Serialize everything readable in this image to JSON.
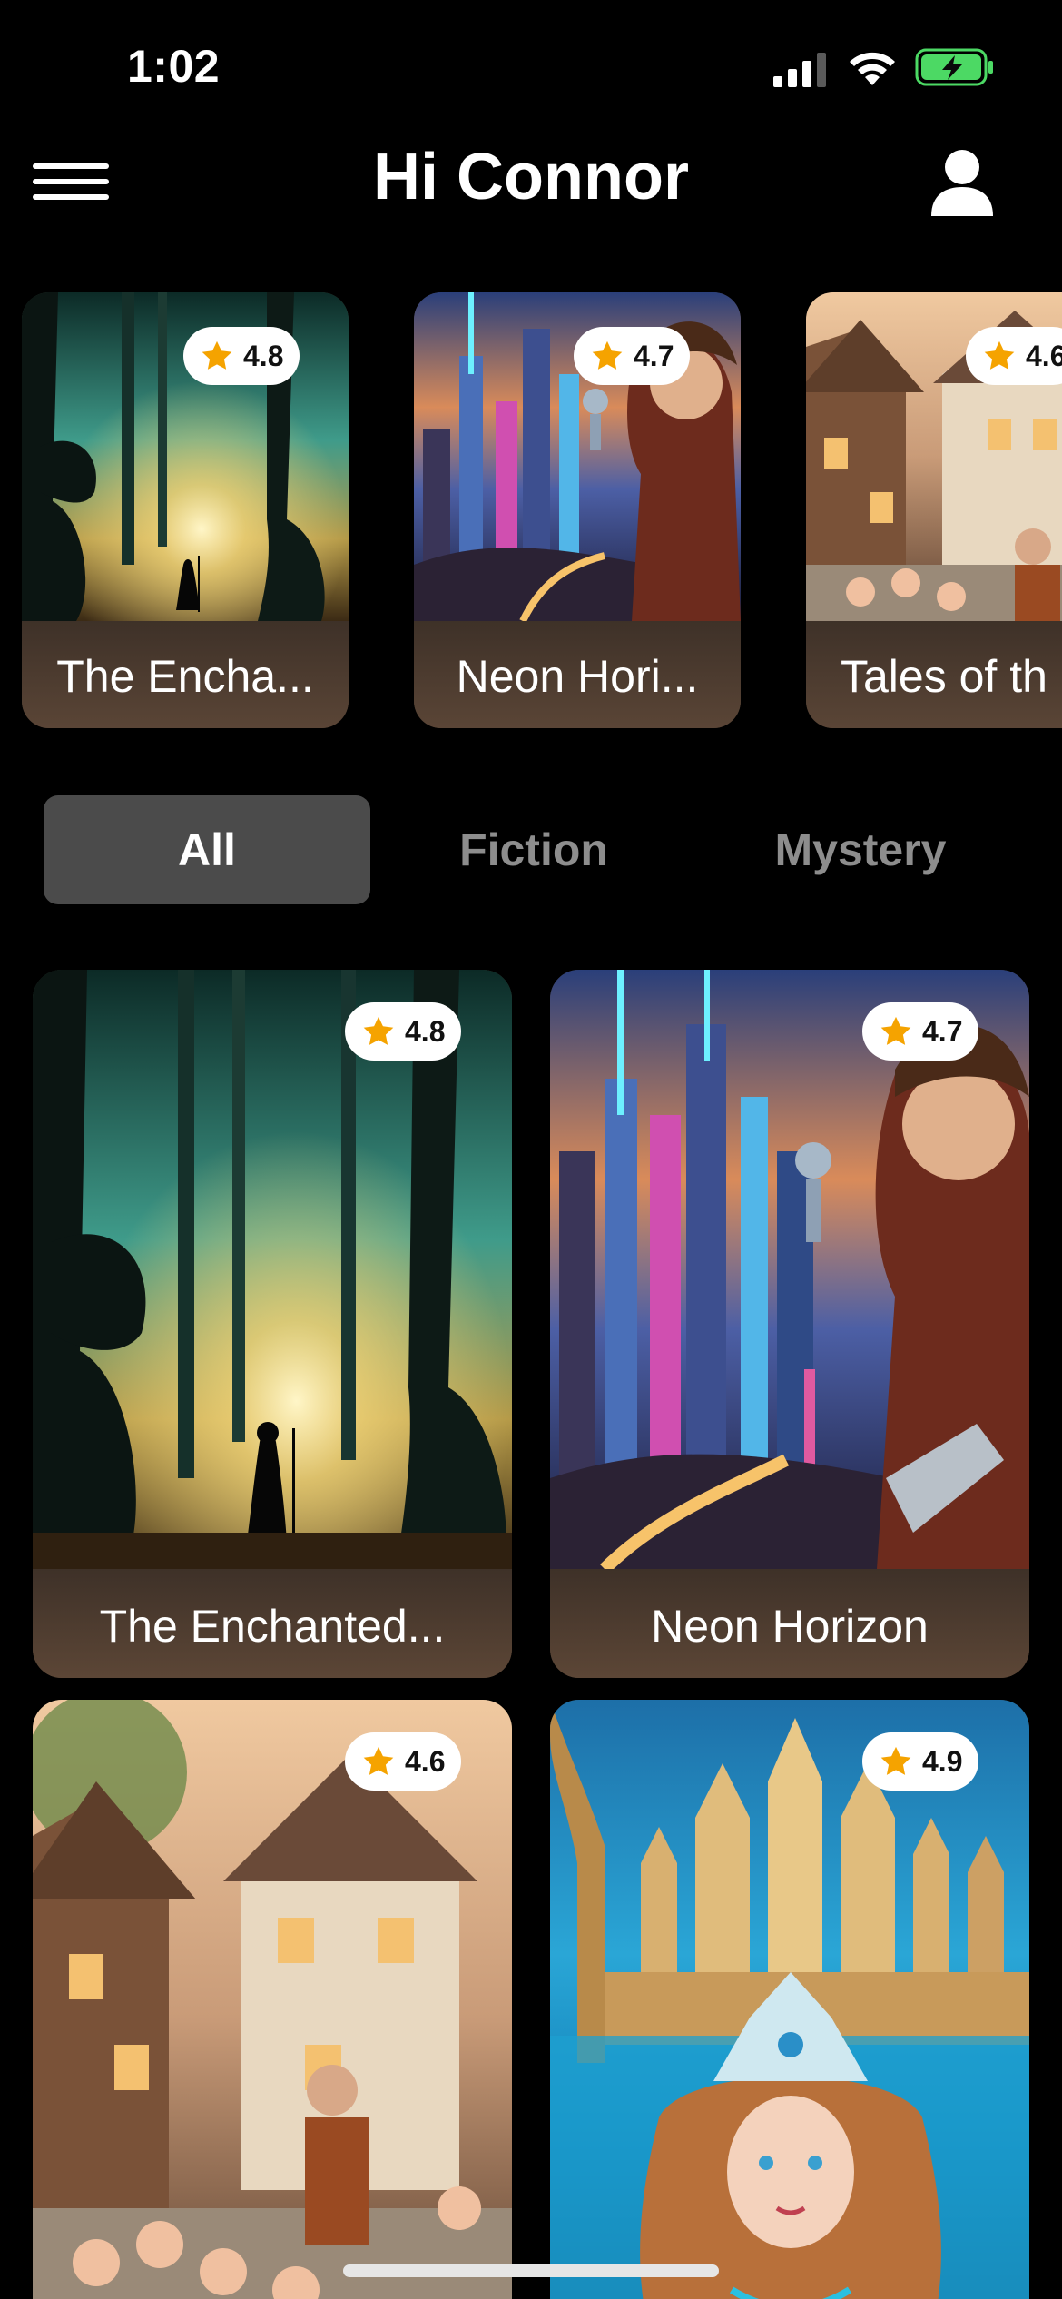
{
  "status_bar": {
    "time": "1:02",
    "signal_icon": "signal-bars-icon",
    "wifi_icon": "wifi-icon",
    "battery_icon": "battery-charging-icon"
  },
  "header": {
    "greeting": "Hi Connor",
    "menu_icon": "hamburger-menu-icon",
    "profile_icon": "user-profile-icon"
  },
  "featured": [
    {
      "title": "The Encha...",
      "rating": "4.8"
    },
    {
      "title": "Neon Hori...",
      "rating": "4.7"
    },
    {
      "title": "Tales of th",
      "rating": "4.6"
    }
  ],
  "tabs": [
    {
      "label": "All",
      "active": true
    },
    {
      "label": "Fiction",
      "active": false
    },
    {
      "label": "Mystery",
      "active": false
    }
  ],
  "books": [
    {
      "title": "The Enchanted...",
      "rating": "4.8"
    },
    {
      "title": "Neon Horizon",
      "rating": "4.7"
    },
    {
      "title": "",
      "rating": "4.6"
    },
    {
      "title": "",
      "rating": "4.9"
    }
  ],
  "colors": {
    "background": "#000000",
    "tab_active_bg": "#4b4b4b",
    "tab_inactive_text": "#8d8d8d",
    "star": "#f5a300",
    "battery": "#4cd964",
    "caption_bg": "#4a3a2c"
  }
}
